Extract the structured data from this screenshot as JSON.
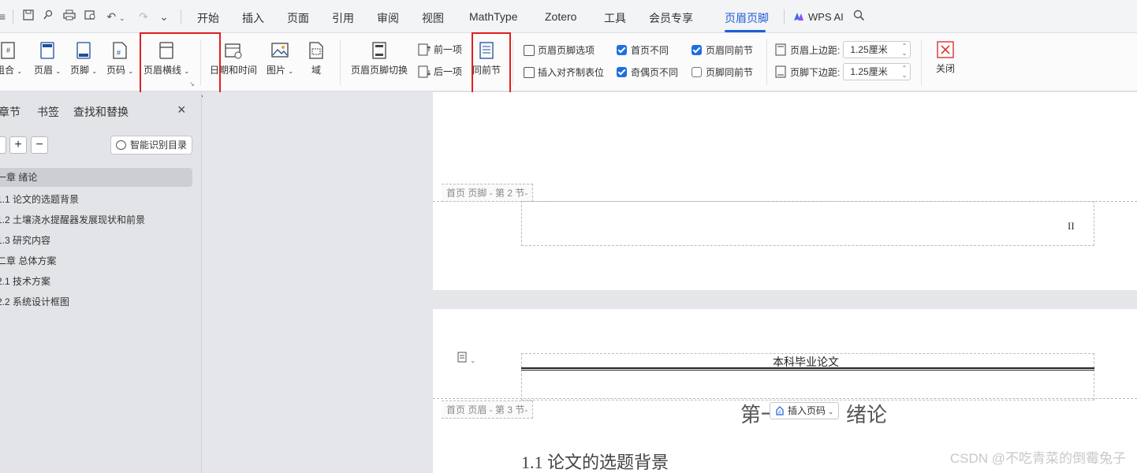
{
  "quick_access": {
    "icons": [
      "menu-icon",
      "save-icon",
      "format-painter-icon",
      "print-icon",
      "print-preview-icon",
      "undo-icon",
      "redo-icon",
      "more-icon"
    ]
  },
  "tabs": [
    {
      "label": "开始"
    },
    {
      "label": "插入"
    },
    {
      "label": "页面"
    },
    {
      "label": "引用"
    },
    {
      "label": "审阅"
    },
    {
      "label": "视图"
    },
    {
      "label": "MathType"
    },
    {
      "label": "Zotero"
    },
    {
      "label": "工具"
    },
    {
      "label": "会员专享"
    },
    {
      "label": "页眉页脚",
      "active": true
    }
  ],
  "wps_ai": "WPS AI",
  "ribbon": {
    "combo": "组合",
    "header": "页眉",
    "footer": "页脚",
    "page_number": "页码",
    "header_line": "页眉横线",
    "date_time": "日期和时间",
    "picture": "图片",
    "field": "域",
    "switch_hf": "页眉页脚切换",
    "prev": "前一项",
    "next": "后一项",
    "same_as_prev": "同前节",
    "hf_options": "页眉页脚选项",
    "insert_align_tab": "插入对齐制表位",
    "first_page_diff": {
      "label": "首页不同",
      "checked": true
    },
    "odd_even_diff": {
      "label": "奇偶页不同",
      "checked": true
    },
    "header_same_prev": {
      "label": "页眉同前节",
      "checked": true
    },
    "footer_same_prev": {
      "label": "页脚同前节",
      "checked": false
    },
    "header_top_margin": {
      "label": "页眉上边距:",
      "value": "1.25厘米"
    },
    "footer_bottom_margin": {
      "label": "页脚下边距:",
      "value": "1.25厘米"
    },
    "close": "关闭"
  },
  "sidebar": {
    "tabs": [
      "章节",
      "书签",
      "查找和替换"
    ],
    "smart_toc": "智能识别目录",
    "items": [
      {
        "label": "一章  绪论",
        "selected": true
      },
      {
        "label": "1.1 论文的选题背景"
      },
      {
        "label": "1.2 土壤浇水提醒器发展现状和前景"
      },
      {
        "label": "1.3 研究内容"
      },
      {
        "label": "二章 总体方案"
      },
      {
        "label": "2.1 技术方案"
      },
      {
        "label": "2.2 系统设计框图"
      }
    ]
  },
  "document": {
    "page1_footer_label": "首页 页脚  - 第 2 节-",
    "page1_number": "II",
    "page2_header_label": "首页 页眉  - 第 3 节-",
    "header_text": "本科毕业论文",
    "chapter_title_left": "第一",
    "chapter_title_right": "绪论",
    "insert_page_number": "插入页码",
    "section_title": "1.1 论文的选题背景"
  },
  "watermark": "CSDN @不吃青菜的倒霉兔子"
}
